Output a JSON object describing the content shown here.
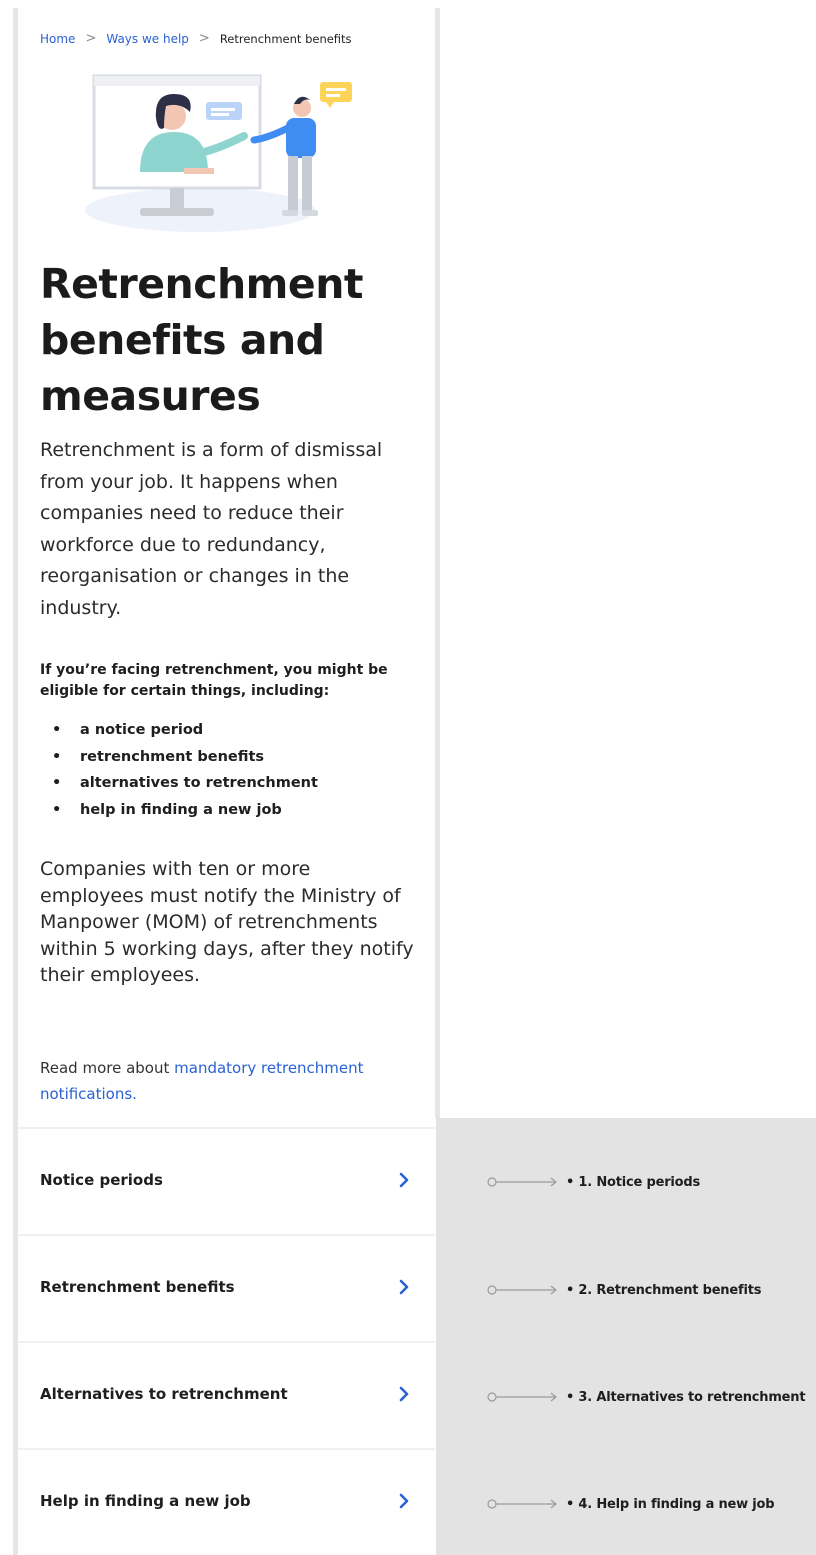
{
  "breadcrumb": {
    "home": "Home",
    "ways": "Ways we help",
    "current": "Retrenchment benefits",
    "separator": ">"
  },
  "hero": {
    "icon": "illustration-consultation"
  },
  "title": "Retrenchment benefits and measures",
  "intro": "Retrenchment is a form of dismissal from your job. It happens when companies need to reduce their workforce due to redundancy, reorganisation or changes in the industry.",
  "eligible": {
    "heading": "If you’re facing retrenchment, you might be eligible for certain things, including:",
    "bullet": "•",
    "items": [
      "a notice period",
      "retrenchment benefits",
      "alternatives to retrenchment",
      "help in finding a new job"
    ]
  },
  "notify": "Companies with ten or more employees must notify the Ministry of Manpower (MOM) of retrenchments within 5 working days, after they notify their employees.",
  "readmore": {
    "prefix": "Read more about ",
    "link": "mandatory retrenchment notifications."
  },
  "accordion": [
    {
      "label": "Notice periods",
      "icon": "chevron-right-icon"
    },
    {
      "label": "Retrenchment benefits",
      "icon": "chevron-right-icon"
    },
    {
      "label": "Alternatives to retrenchment",
      "icon": "chevron-right-icon"
    },
    {
      "label": "Help in finding a new job",
      "icon": "chevron-right-icon"
    }
  ],
  "annotations": [
    "• 1. Notice periods",
    "• 2. Retrenchment benefits",
    "• 3. Alternatives to retrenchment",
    "• 4. Help in finding a new job"
  ],
  "colors": {
    "link": "#2a61d5",
    "text": "#1e1e1e",
    "panel": "#e3e3e3"
  }
}
